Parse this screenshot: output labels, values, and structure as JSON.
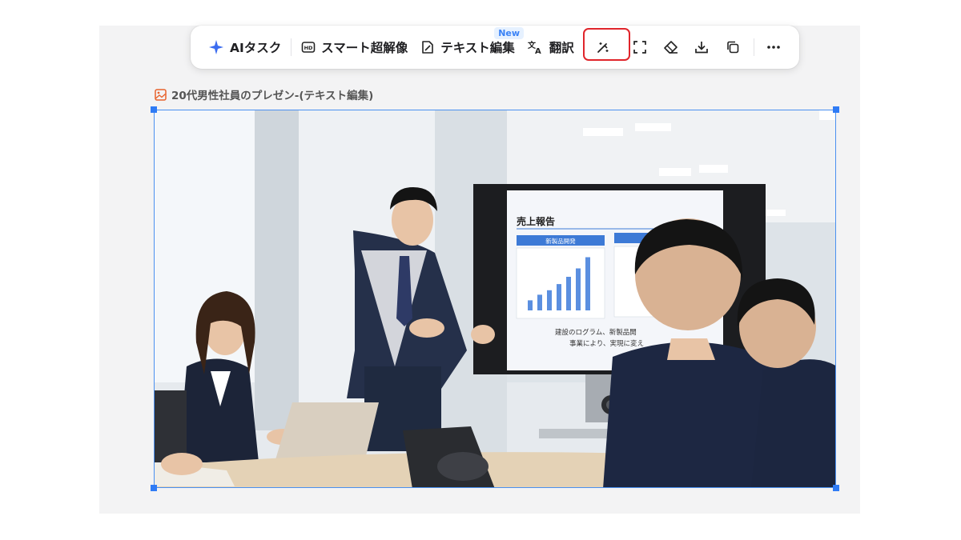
{
  "toolbar": {
    "ai_task": "AIタスク",
    "super_resolution": "スマート超解像",
    "text_edit": "テキスト編集",
    "new_badge": "New",
    "translate": "翻訳",
    "icons": [
      "magic-wand-icon",
      "fullscreen-icon",
      "eraser-icon",
      "download-icon",
      "copy-icon",
      "more-icon"
    ]
  },
  "image": {
    "title": "20代男性社員のプレゼン-(テキスト編集)",
    "slide_title": "売上報告",
    "slide_header_left": "新製品開発",
    "slide_text_line1": "建設のログラム、新製品開",
    "slide_text_line2": "事業により、実現に変え",
    "bar_values": [
      0.18,
      0.28,
      0.36,
      0.47,
      0.6,
      0.75,
      0.95
    ]
  },
  "colors": {
    "accent": "#2f7bf5",
    "highlight": "#e0252b",
    "slide_header": "#3d7ad6",
    "bar": "#5b8fe0"
  }
}
